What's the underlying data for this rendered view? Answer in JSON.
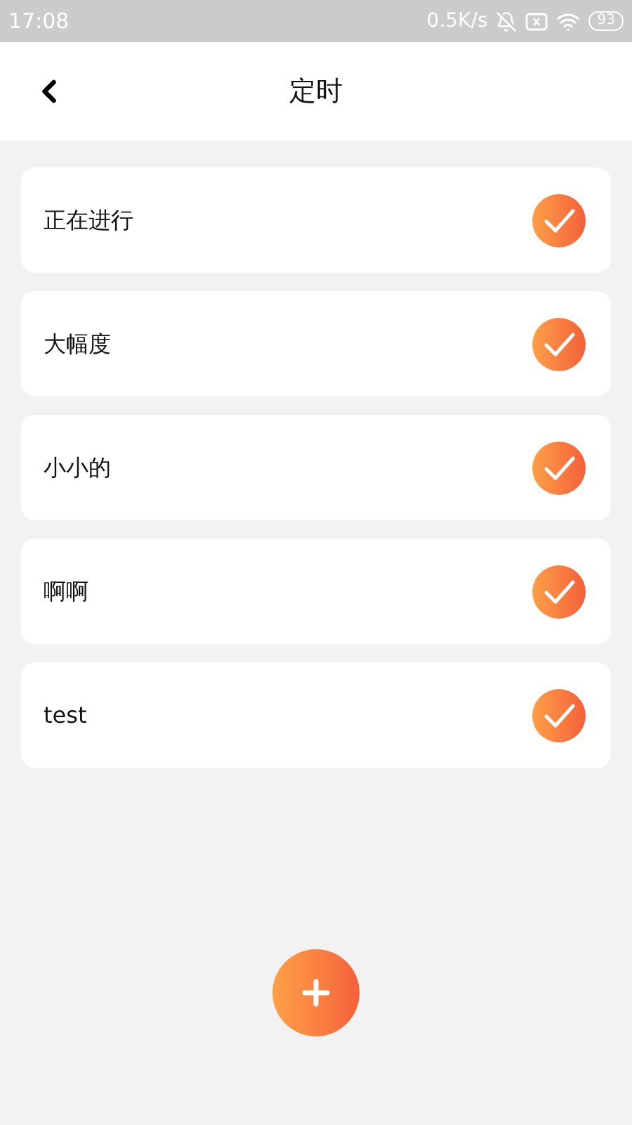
{
  "status_bar": {
    "time": "17:08",
    "speed": "0.5K/s",
    "battery": "93"
  },
  "header": {
    "title": "定时"
  },
  "timers": [
    {
      "name": "正在进行",
      "checked": true
    },
    {
      "name": "大幅度",
      "checked": true
    },
    {
      "name": "小小的",
      "checked": true
    },
    {
      "name": "啊啊",
      "checked": true
    },
    {
      "name": "test",
      "checked": true
    }
  ]
}
